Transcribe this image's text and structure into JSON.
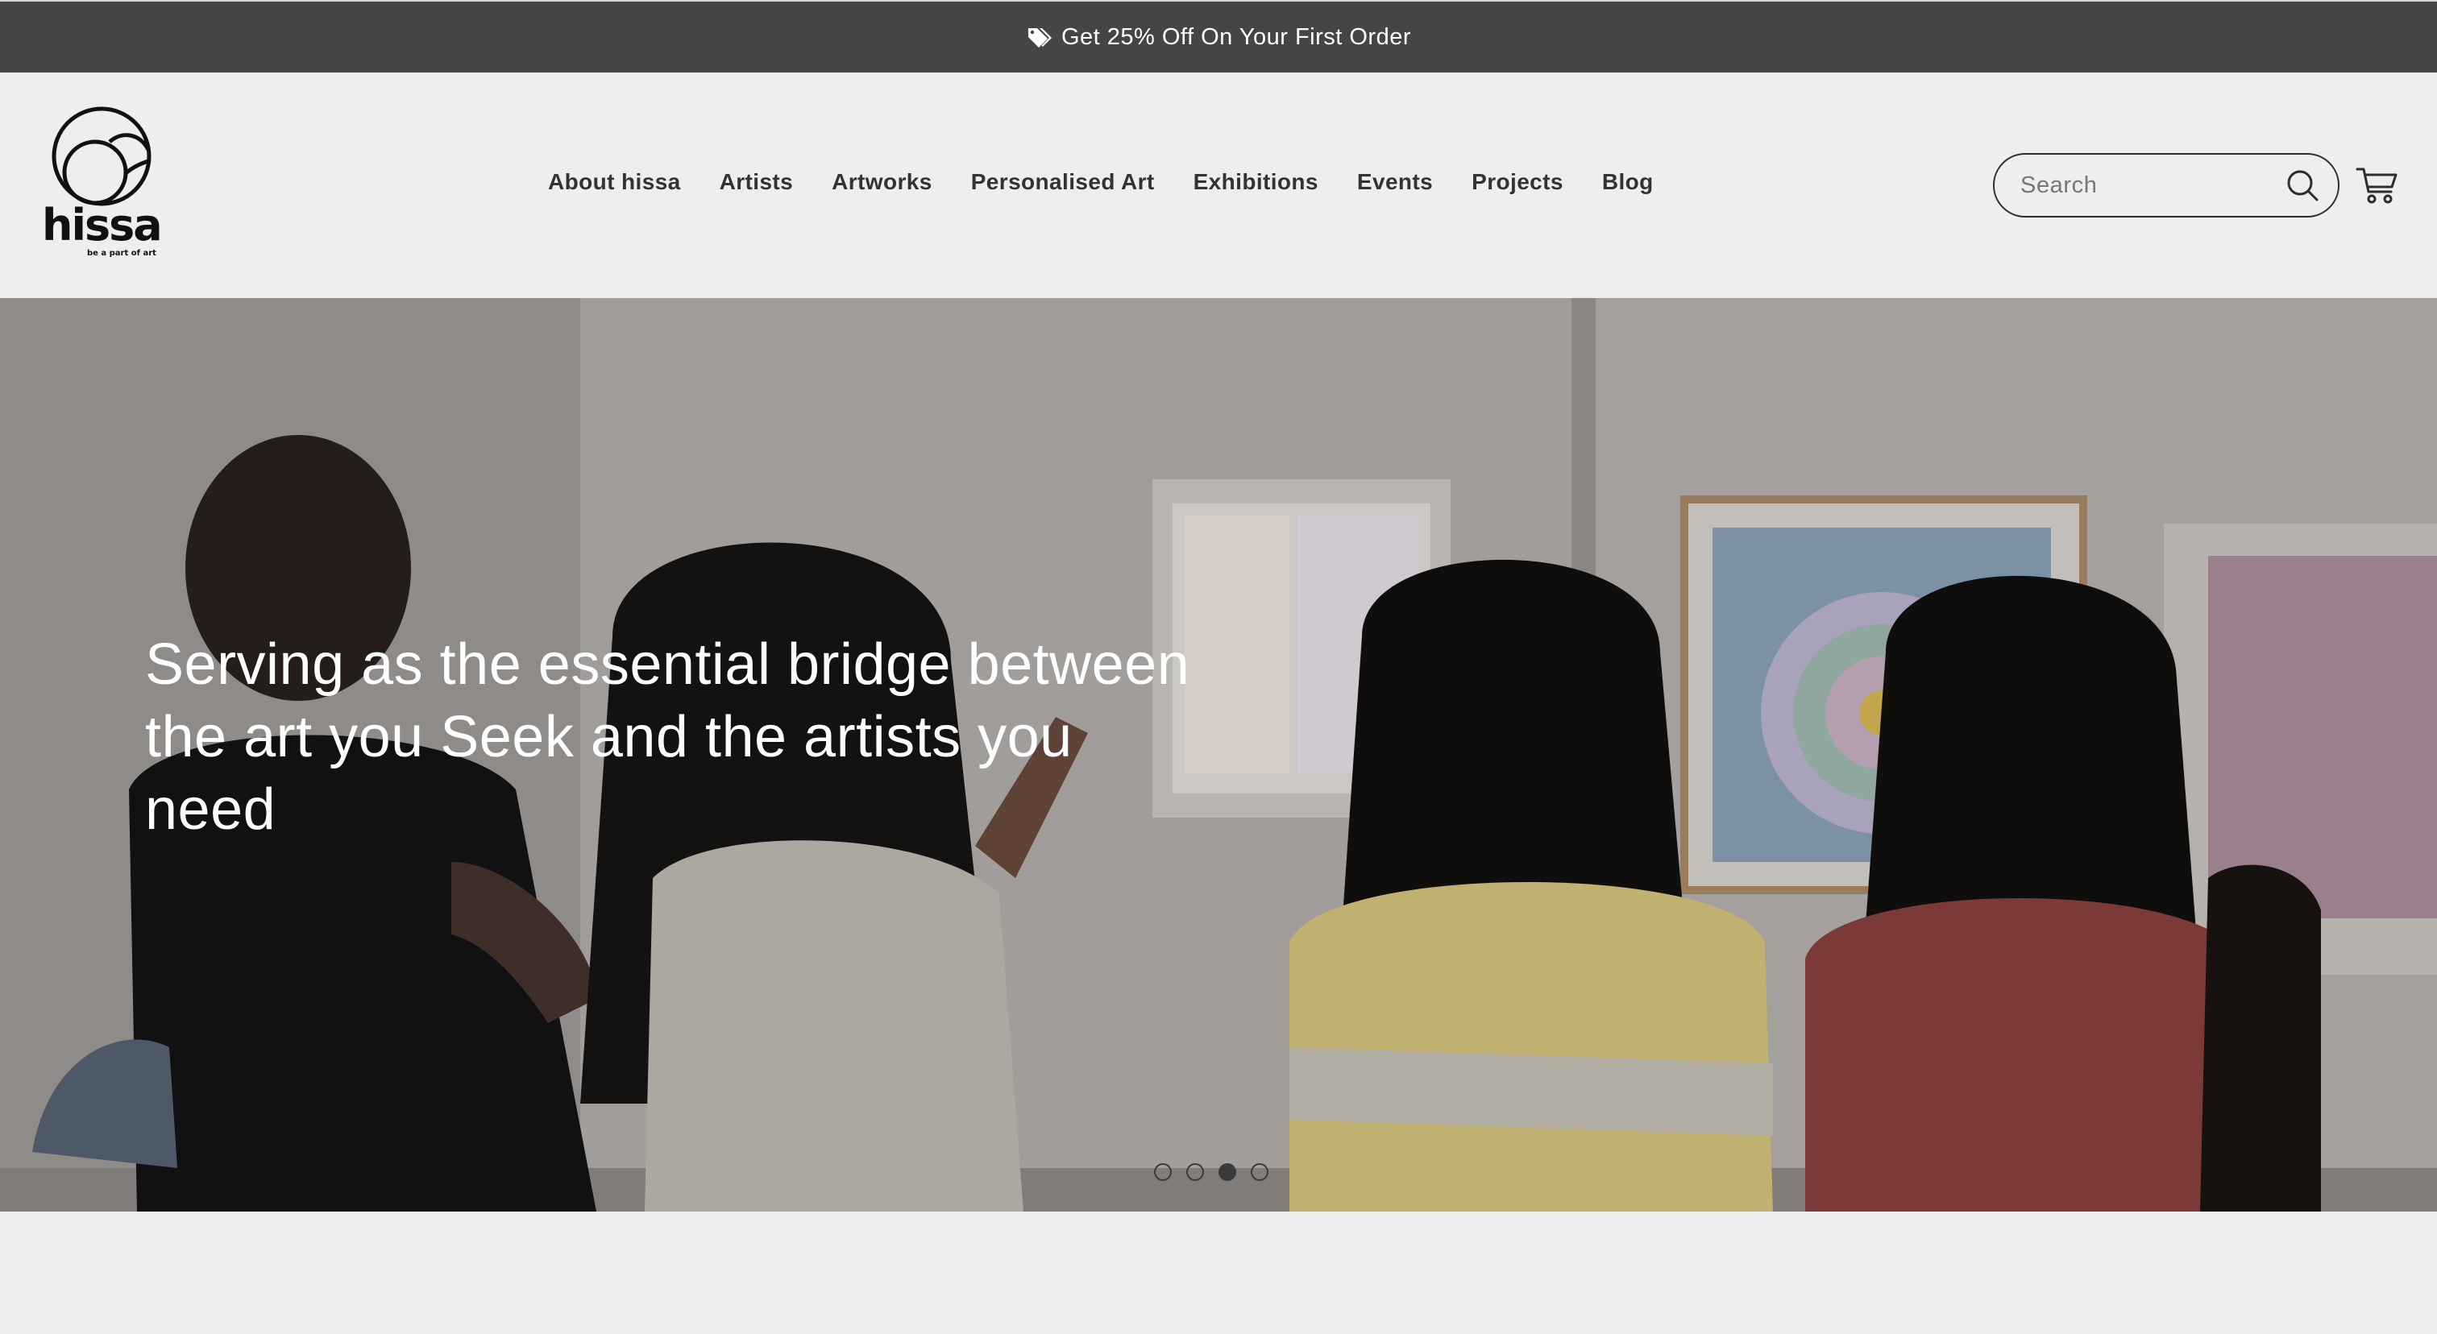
{
  "announcement": {
    "text": "Get 25% Off On Your First Order",
    "icon": "tags-icon"
  },
  "brand": {
    "name": "hissa",
    "tagline": "be a part of art"
  },
  "nav": {
    "items": [
      {
        "label": "About hissa"
      },
      {
        "label": "Artists"
      },
      {
        "label": "Artworks"
      },
      {
        "label": "Personalised Art"
      },
      {
        "label": "Exhibitions"
      },
      {
        "label": "Events"
      },
      {
        "label": "Projects"
      },
      {
        "label": "Blog"
      }
    ]
  },
  "search": {
    "placeholder": "Search",
    "icon": "search-icon"
  },
  "cart": {
    "icon": "cart-icon"
  },
  "hero": {
    "heading": "Serving as the essential bridge between the art you Seek and the artists you need",
    "slides_total": 4,
    "active_slide": 3
  },
  "colors": {
    "announcement_bg": "#454545",
    "header_bg": "#eeeeee",
    "text_dark": "#333333",
    "hero_text": "#ffffff"
  }
}
